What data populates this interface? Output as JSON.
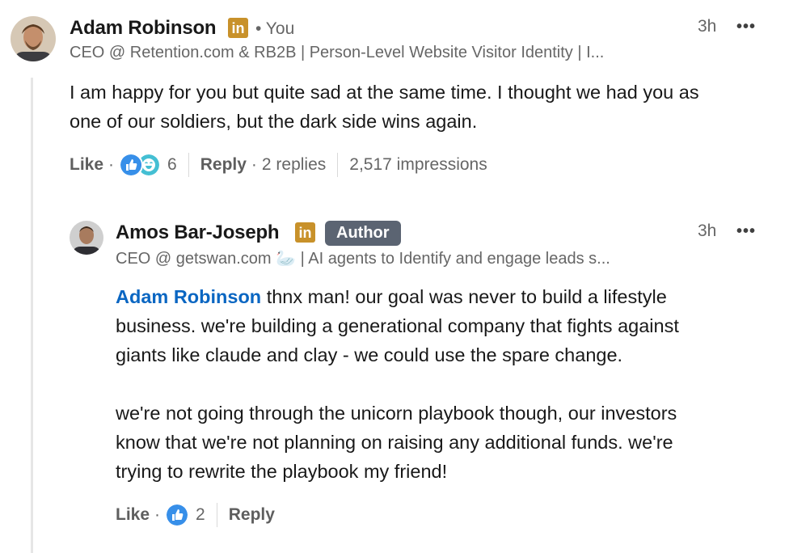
{
  "comment1": {
    "author": "Adam Robinson",
    "linkedin_badge": "in",
    "you_label": "• You",
    "headline": "CEO @ Retention.com & RB2B | Person-Level Website Visitor Identity | I...",
    "time": "3h",
    "more": "•••",
    "text_line1": "I am happy for you but quite sad at the same time. I thought we had you as",
    "text_line2": "one of our soldiers, but the dark side wins again.",
    "actions": {
      "like": "Like",
      "dot1": "·",
      "reaction_icons": [
        "like-icon",
        "funny-icon"
      ],
      "reaction_count": "6",
      "reply": "Reply",
      "dot2": "·",
      "replies": "2 replies",
      "impressions": "2,517 impressions"
    }
  },
  "comment2": {
    "author": "Amos Bar-Joseph",
    "linkedin_badge": "in",
    "author_badge": "Author",
    "headline": "CEO @ getswan.com 🦢 | AI agents to Identify and engage leads s...",
    "time": "3h",
    "more": "•••",
    "mention": "Adam Robinson",
    "text_p1_line1": " thnx man! our goal was never to build a lifestyle",
    "text_p1_line2": "business. we're building a generational company that fights against",
    "text_p1_line3": "giants like claude and clay - we could use the spare change.",
    "text_p2_line1": "we're not going through the unicorn playbook though, our investors",
    "text_p2_line2": "know that we're not planning on raising any additional funds. we're",
    "text_p2_line3": "trying to rewrite the playbook my friend!",
    "actions": {
      "like": "Like",
      "dot1": "·",
      "reaction_icons": [
        "like-icon"
      ],
      "reaction_count": "2",
      "reply": "Reply"
    }
  },
  "colors": {
    "mention": "#0a66c2",
    "linkedin_badge": "#c8912a",
    "author_badge": "#5b6472",
    "like_icon": "#378fe9",
    "funny_icon": "#44bfd3"
  }
}
